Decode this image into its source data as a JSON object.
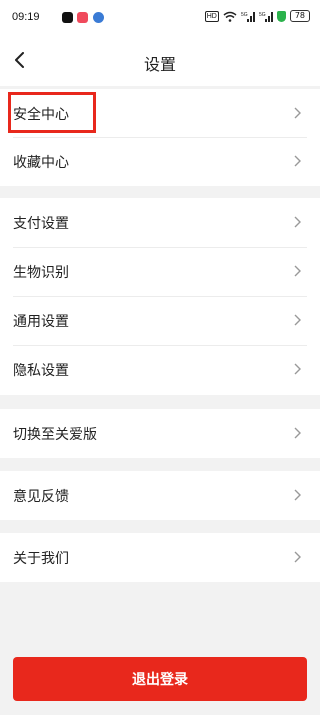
{
  "status_bar": {
    "time": "09:19",
    "hd_label": "HD",
    "signal1": "5G",
    "signal2": "5G",
    "battery": "78",
    "icons": [
      "app-icon-1",
      "app-icon-2",
      "app-icon-3",
      "wifi-icon",
      "signal-icon",
      "signal-icon",
      "shield-icon",
      "battery-icon"
    ]
  },
  "nav": {
    "title": "设置",
    "back_icon": "chevron-left-icon"
  },
  "groups": [
    {
      "items": [
        {
          "label": "安全中心"
        },
        {
          "label": "收藏中心"
        }
      ]
    },
    {
      "items": [
        {
          "label": "支付设置"
        },
        {
          "label": "生物识别"
        },
        {
          "label": "通用设置"
        },
        {
          "label": "隐私设置"
        }
      ]
    },
    {
      "items": [
        {
          "label": "切换至关爱版"
        }
      ]
    },
    {
      "items": [
        {
          "label": "意见反馈"
        }
      ]
    },
    {
      "items": [
        {
          "label": "关于我们"
        }
      ]
    }
  ],
  "logout_label": "退出登录",
  "colors": {
    "accent": "#e8281c",
    "background": "#f2f2f2",
    "card": "#ffffff"
  }
}
